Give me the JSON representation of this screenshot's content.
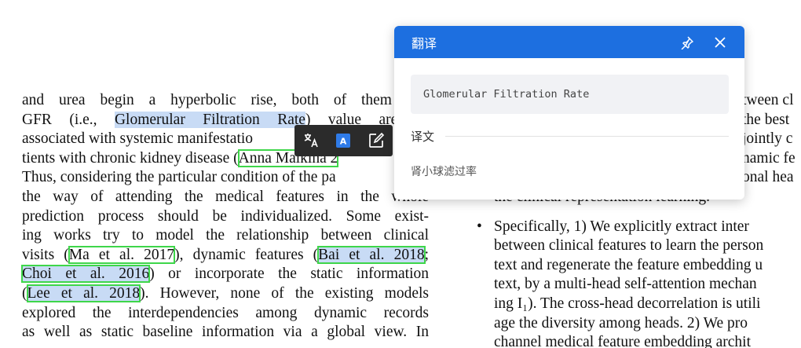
{
  "document": {
    "left_lines": [
      [
        "and urea begin a hyperbolic rise, both of them and"
      ],
      [
        "GFR (i.e., ",
        "Glomerular Filtration Rate",
        ") value are us"
      ],
      [
        "associated with systemic manifestatio"
      ],
      [
        "tients with chronic kidney disease (",
        "Anna Malkina 2",
        ""
      ],
      [
        "Thus, considering the particular condition of the pa"
      ],
      [
        "the way of attending the medical features in the whole"
      ],
      [
        "prediction process should be individualized. Some exist-"
      ],
      [
        "ing works try to model the relationship between clinical"
      ],
      [
        "visits (",
        "Ma et al. 2017",
        "), dynamic features (",
        "Bai et al. 2018",
        ";"
      ],
      [
        "Choi et al. 2016",
        ") or incorporate the static information"
      ],
      [
        "(",
        "Lee et al. 2018",
        "). However, none of the existing models"
      ],
      [
        "explored the interdependencies among dynamic records"
      ],
      [
        "as well as static baseline information via a global view. In"
      ]
    ],
    "right_lines": [
      "tween cl",
      "the best",
      "jointly c",
      "namic fe",
      "onal hea",
      "the clinical representation learning."
    ],
    "right_bullet_lines": [
      "Specifically, 1) We explicitly extract inter",
      "between clinical features to learn the person",
      "text and regenerate the feature embedding u",
      "text, by a multi-head self-attention mechan",
      "ing I₁). The cross-head decorrelation is utili",
      "age the diversity among heads. 2) We pro",
      "channel medical feature embedding archit"
    ],
    "bullet": "•"
  },
  "toolbar": {
    "items": [
      "translate-icon",
      "highlight-icon",
      "edit-note-icon"
    ],
    "highlight_letter": "A"
  },
  "popup": {
    "title": "翻译",
    "source_text": "Glomerular Filtration Rate",
    "result_label": "译文",
    "result_text": "肾小球滤过率",
    "colors": {
      "header": "#1d6fe0",
      "source_bg": "#f1f2f5"
    }
  }
}
